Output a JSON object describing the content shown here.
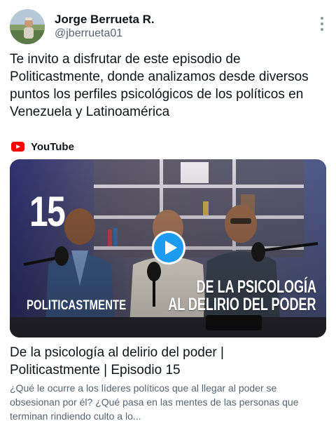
{
  "author": {
    "name": "Jorge Berrueta R.",
    "handle": "@jberrueta01"
  },
  "tweet": {
    "text": "Te invito a disfrutar de este episodio de\nPoliticastmente, donde analizamos desde diversos\npuntos los perfiles psicológicos de los políticos en\nVenezuela y Latinoamérica"
  },
  "card": {
    "source": "YouTube",
    "source_icon": "youtube-logo-icon",
    "thumbnail": {
      "episode_number": "15",
      "show_name": "POLITICASTMENTE",
      "headline_line1": "DE LA PSICOLOGÍA",
      "headline_line2": "AL DELIRIO DEL PODER",
      "play_icon": "play-icon"
    },
    "title": "De la psicología al delirio del poder |\nPoliticastmente | Episodio 15",
    "description": "¿Qué le ocurre a los líderes políticos que al llegar al poder se obsesionan por él? ¿Qué pasa en las mentes de las personas que terminan rindiendo culto a lo..."
  },
  "colors": {
    "text_primary": "#0f1419",
    "text_secondary": "#536471",
    "accent": "#1d9bf0",
    "youtube_red": "#ff0000"
  }
}
